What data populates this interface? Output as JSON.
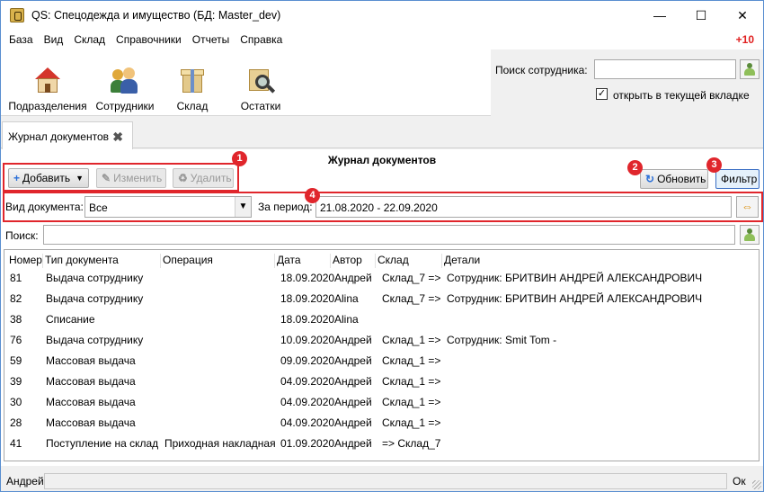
{
  "window": {
    "title": "QS: Спецодежда и имущество (БД: Master_dev)"
  },
  "menu": {
    "items": [
      "База",
      "Вид",
      "Склад",
      "Справочники",
      "Отчеты",
      "Справка"
    ],
    "badge": "+10"
  },
  "toolbar": {
    "buttons": [
      {
        "label": "Подразделения",
        "icon": "house-icon"
      },
      {
        "label": "Сотрудники",
        "icon": "people-icon"
      },
      {
        "label": "Склад",
        "icon": "box-icon"
      },
      {
        "label": "Остатки",
        "icon": "magnifier-box-icon"
      }
    ]
  },
  "employee_search": {
    "label": "Поиск сотрудника:",
    "value": "",
    "open_in_tab_label": "открыть в текущей вкладке",
    "open_in_tab_checked": true
  },
  "tab": {
    "label": "Журнал документов"
  },
  "journal": {
    "title": "Журнал документов",
    "add_label": "Добавить",
    "edit_label": "Изменить",
    "delete_label": "Удалить",
    "refresh_label": "Обновить",
    "filter_label": "Фильтр",
    "doc_type_label": "Вид документа:",
    "doc_type_value": "Все",
    "period_label": "За период:",
    "period_value": "21.08.2020 - 22.09.2020",
    "search_label": "Поиск:",
    "search_value": ""
  },
  "markers": [
    "1",
    "2",
    "3",
    "4"
  ],
  "table": {
    "columns": [
      "Номер",
      "Тип документа",
      "Операция",
      "Дата",
      "Автор",
      "Склад",
      "Детали"
    ],
    "rows": [
      [
        "81",
        "Выдача сотруднику",
        "",
        "18.09.2020",
        "Андрей",
        "Склад_7 =>",
        "Сотрудник: БРИТВИН АНДРЕЙ АЛЕКСАНДРОВИЧ"
      ],
      [
        "82",
        "Выдача сотруднику",
        "",
        "18.09.2020",
        "Alina",
        "Склад_7 =>",
        "Сотрудник: БРИТВИН АНДРЕЙ АЛЕКСАНДРОВИЧ"
      ],
      [
        "38",
        "Списание",
        "",
        "18.09.2020",
        "Alina",
        "",
        ""
      ],
      [
        "76",
        "Выдача сотруднику",
        "",
        "10.09.2020",
        "Андрей",
        "Склад_1 =>",
        "Сотрудник: Smit Tom -"
      ],
      [
        "59",
        "Массовая выдача",
        "",
        "09.09.2020",
        "Андрей",
        "Склад_1 =>",
        ""
      ],
      [
        "39",
        "Массовая выдача",
        "",
        "04.09.2020",
        "Андрей",
        "Склад_1 =>",
        ""
      ],
      [
        "30",
        "Массовая выдача",
        "",
        "04.09.2020",
        "Андрей",
        "Склад_1 =>",
        ""
      ],
      [
        "28",
        "Массовая выдача",
        "",
        "04.09.2020",
        "Андрей",
        "Склад_1 =>",
        ""
      ],
      [
        "41",
        "Поступление на склад",
        "Приходная накладная",
        "01.09.2020",
        "Андрей",
        "=> Склад_7",
        ""
      ]
    ]
  },
  "status": {
    "user": "Андрей",
    "state": "Ок"
  },
  "colors": {
    "annotation": "#e0262c",
    "badge": "#e02020"
  }
}
